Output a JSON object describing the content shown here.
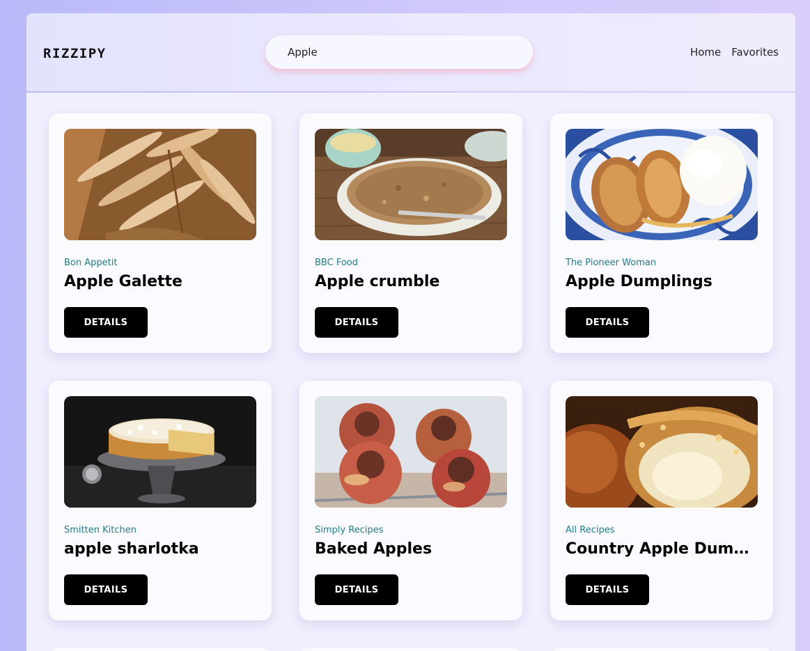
{
  "header": {
    "logo": "RIZZIPY",
    "search": {
      "value": "Apple",
      "placeholder": ""
    },
    "nav": [
      {
        "label": "Home"
      },
      {
        "label": "Favorites"
      }
    ]
  },
  "recipes": [
    {
      "source": "Bon Appetit",
      "title": "Apple Galette",
      "button": "DETAILS"
    },
    {
      "source": "BBC Food",
      "title": "Apple crumble",
      "button": "DETAILS"
    },
    {
      "source": "The Pioneer Woman",
      "title": "Apple Dumplings",
      "button": "DETAILS"
    },
    {
      "source": "Smitten Kitchen",
      "title": "apple sharlotka",
      "button": "DETAILS"
    },
    {
      "source": "Simply Recipes",
      "title": "Baked Apples",
      "button": "DETAILS"
    },
    {
      "source": "All Recipes",
      "title": "Country Apple Dumplings",
      "button": "DETAILS"
    }
  ],
  "colors": {
    "accent_source": "#1f7c8f",
    "button_bg": "#000000",
    "search_glow": "#f4a0b4"
  }
}
